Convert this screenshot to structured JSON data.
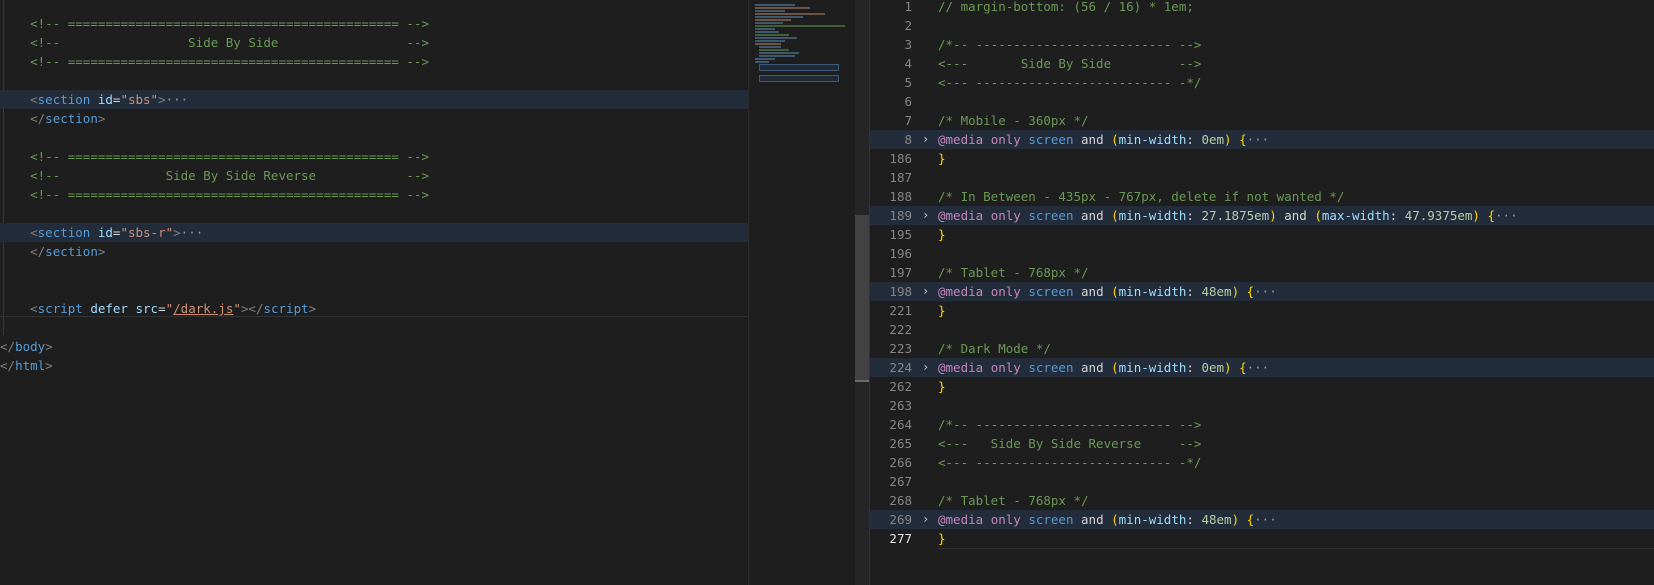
{
  "left_editor": {
    "lines": [
      {
        "type": "comment",
        "text": "<!-- ============================================ -->"
      },
      {
        "type": "comment",
        "text": "<!--                 Side By Side                 -->"
      },
      {
        "type": "comment",
        "text": "<!-- ============================================ -->"
      },
      {
        "type": "blank"
      },
      {
        "type": "tag",
        "highlight": true,
        "indent": "    ",
        "tag": "section",
        "attr": "id",
        "value": "\"sbs\"",
        "fold": "···"
      },
      {
        "type": "close",
        "indent": "    ",
        "tag": "section"
      },
      {
        "type": "blank"
      },
      {
        "type": "comment",
        "text": "<!-- ============================================ -->"
      },
      {
        "type": "comment",
        "text": "<!--              Side By Side Reverse            -->"
      },
      {
        "type": "comment",
        "text": "<!-- ============================================ -->"
      },
      {
        "type": "blank"
      },
      {
        "type": "tag",
        "highlight": true,
        "indent": "    ",
        "tag": "section",
        "attr": "id",
        "value": "\"sbs-r\"",
        "fold": "···"
      },
      {
        "type": "close",
        "indent": "    ",
        "tag": "section"
      },
      {
        "type": "blank"
      },
      {
        "type": "blank"
      },
      {
        "type": "script",
        "indent": "    ",
        "tag": "script",
        "attr1": "defer",
        "attr2": "src",
        "value_open": "\"",
        "value_link": "/dark.js",
        "value_close": "\""
      },
      {
        "type": "blank"
      },
      {
        "type": "close",
        "indent": "",
        "tag": "body"
      },
      {
        "type": "close",
        "indent": "",
        "tag": "html"
      }
    ]
  },
  "right_editor": {
    "lines": [
      {
        "num": "1",
        "type": "comment",
        "text": "// margin-bottom: (56 / 16) * 1em;"
      },
      {
        "num": "2",
        "type": "blank"
      },
      {
        "num": "3",
        "type": "comment",
        "text": "/*-- -------------------------- -->"
      },
      {
        "num": "4",
        "type": "comment",
        "text": "<---       Side By Side         -->"
      },
      {
        "num": "5",
        "type": "comment",
        "text": "<--- -------------------------- -*/"
      },
      {
        "num": "6",
        "type": "blank"
      },
      {
        "num": "7",
        "type": "comment",
        "text": "/* Mobile - 360px */"
      },
      {
        "num": "8",
        "type": "media",
        "highlight": true,
        "conds": [
          {
            "prop": "min-width",
            "val": "0em"
          }
        ],
        "fold": "···"
      },
      {
        "num": "186",
        "type": "brace",
        "text": "}"
      },
      {
        "num": "187",
        "type": "blank"
      },
      {
        "num": "188",
        "type": "comment",
        "text": "/* In Between - 435px - 767px, delete if not wanted */"
      },
      {
        "num": "189",
        "type": "media",
        "highlight": true,
        "conds": [
          {
            "prop": "min-width",
            "val": "27.1875em"
          },
          {
            "prop": "max-width",
            "val": "47.9375em"
          }
        ],
        "fold": "···"
      },
      {
        "num": "195",
        "type": "brace",
        "text": "}"
      },
      {
        "num": "196",
        "type": "blank"
      },
      {
        "num": "197",
        "type": "comment",
        "text": "/* Tablet - 768px */"
      },
      {
        "num": "198",
        "type": "media",
        "highlight": true,
        "conds": [
          {
            "prop": "min-width",
            "val": "48em"
          }
        ],
        "fold": "···"
      },
      {
        "num": "221",
        "type": "brace",
        "text": "}"
      },
      {
        "num": "222",
        "type": "blank"
      },
      {
        "num": "223",
        "type": "comment",
        "text": "/* Dark Mode */"
      },
      {
        "num": "224",
        "type": "media",
        "highlight": true,
        "conds": [
          {
            "prop": "min-width",
            "val": "0em"
          }
        ],
        "fold": "···"
      },
      {
        "num": "262",
        "type": "brace",
        "text": "}"
      },
      {
        "num": "263",
        "type": "blank"
      },
      {
        "num": "264",
        "type": "comment",
        "text": "/*-- -------------------------- -->"
      },
      {
        "num": "265",
        "type": "comment",
        "text": "<---   Side By Side Reverse     -->"
      },
      {
        "num": "266",
        "type": "comment",
        "text": "<--- -------------------------- -*/"
      },
      {
        "num": "267",
        "type": "blank"
      },
      {
        "num": "268",
        "type": "comment",
        "text": "/* Tablet - 768px */"
      },
      {
        "num": "269",
        "type": "media",
        "highlight": true,
        "conds": [
          {
            "prop": "min-width",
            "val": "48em"
          }
        ],
        "fold": "···"
      },
      {
        "num": "277",
        "type": "brace",
        "current": true,
        "text": "}"
      }
    ],
    "media_keywords": {
      "at": "@media",
      "only": "only",
      "screen": "screen",
      "and": "and"
    }
  },
  "colors": {
    "background": "#1e1e1e",
    "comment": "#6a9955",
    "tag": "#569cd6",
    "attribute": "#9cdcfe",
    "string": "#ce9178",
    "keyword": "#c586c0",
    "number": "#b5cea8",
    "bracket": "#ffd700"
  }
}
